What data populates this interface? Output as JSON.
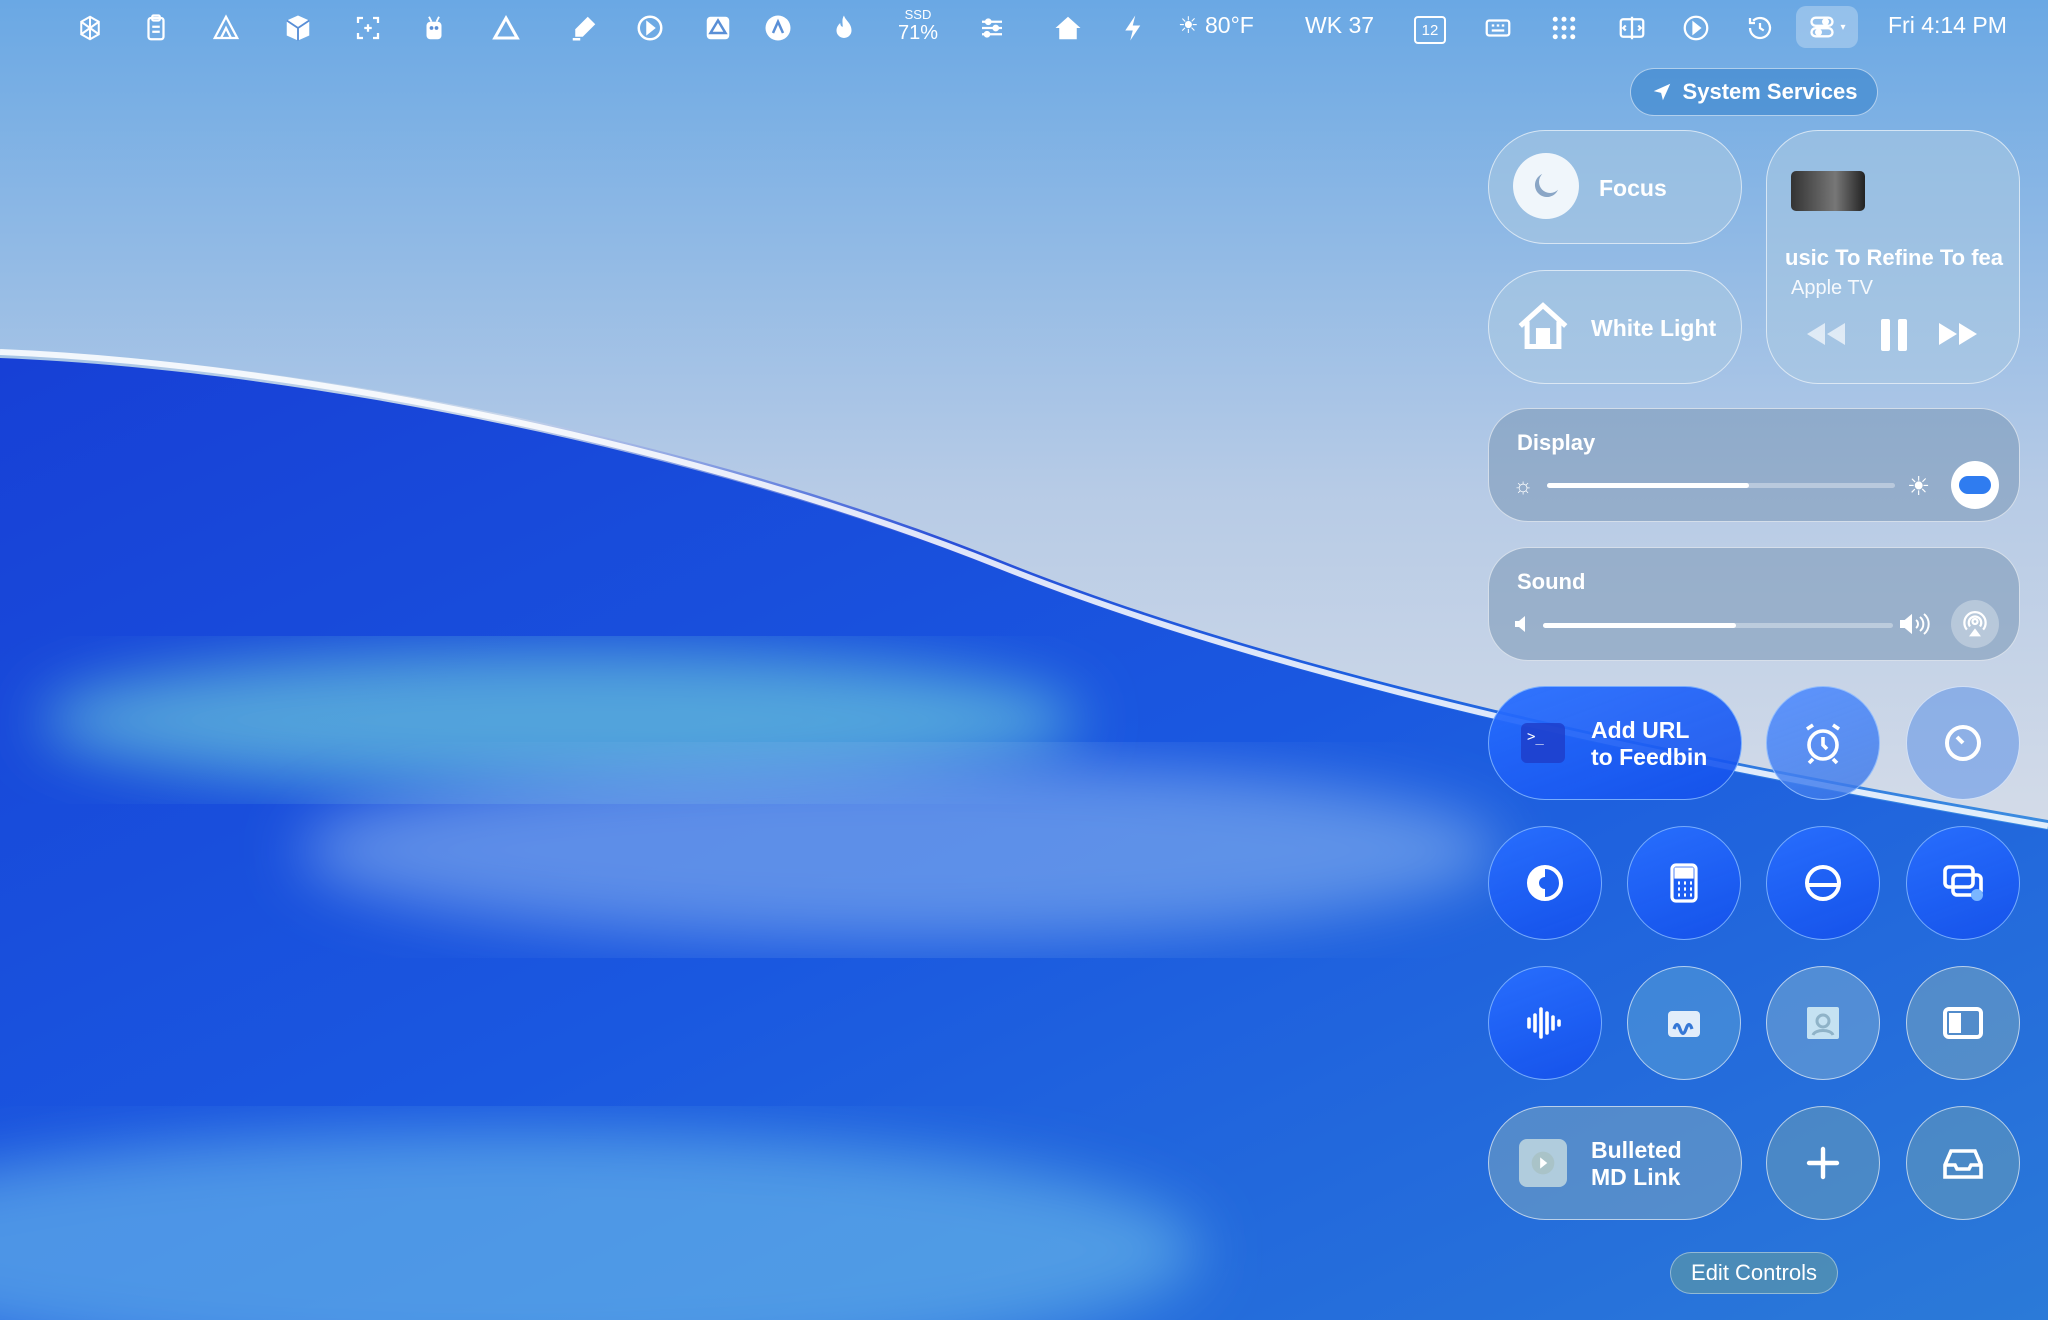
{
  "menubar": {
    "icons": [
      "openai-icon",
      "clipboard-icon",
      "triangle-logo-icon",
      "package-icon",
      "screenshot-icon",
      "robot-icon",
      "delta-icon",
      "highlighter-icon",
      "cleanshot-icon",
      "google-drive-icon",
      "arc-icon",
      "flame-icon"
    ],
    "ssd_label": "SSD",
    "ssd_value": "71%",
    "weather": "☀ 80°F",
    "week": "WK 37",
    "calendar_day": "12",
    "clock": "Fri 4:14 PM"
  },
  "control_center": {
    "system_services_label": "System Services",
    "focus_label": "Focus",
    "home_label": "White Light",
    "now_playing": {
      "title": "usic To Refine To fea",
      "source": "Apple TV"
    },
    "display": {
      "label": "Display",
      "brightness": 0.58
    },
    "sound": {
      "label": "Sound",
      "volume": 0.55
    },
    "shortcut1": {
      "line1": "Add URL",
      "line2": "to Feedbin"
    },
    "shortcut2": {
      "line1": "Bulleted",
      "line2": "MD Link"
    },
    "edit_controls_label": "Edit Controls"
  }
}
